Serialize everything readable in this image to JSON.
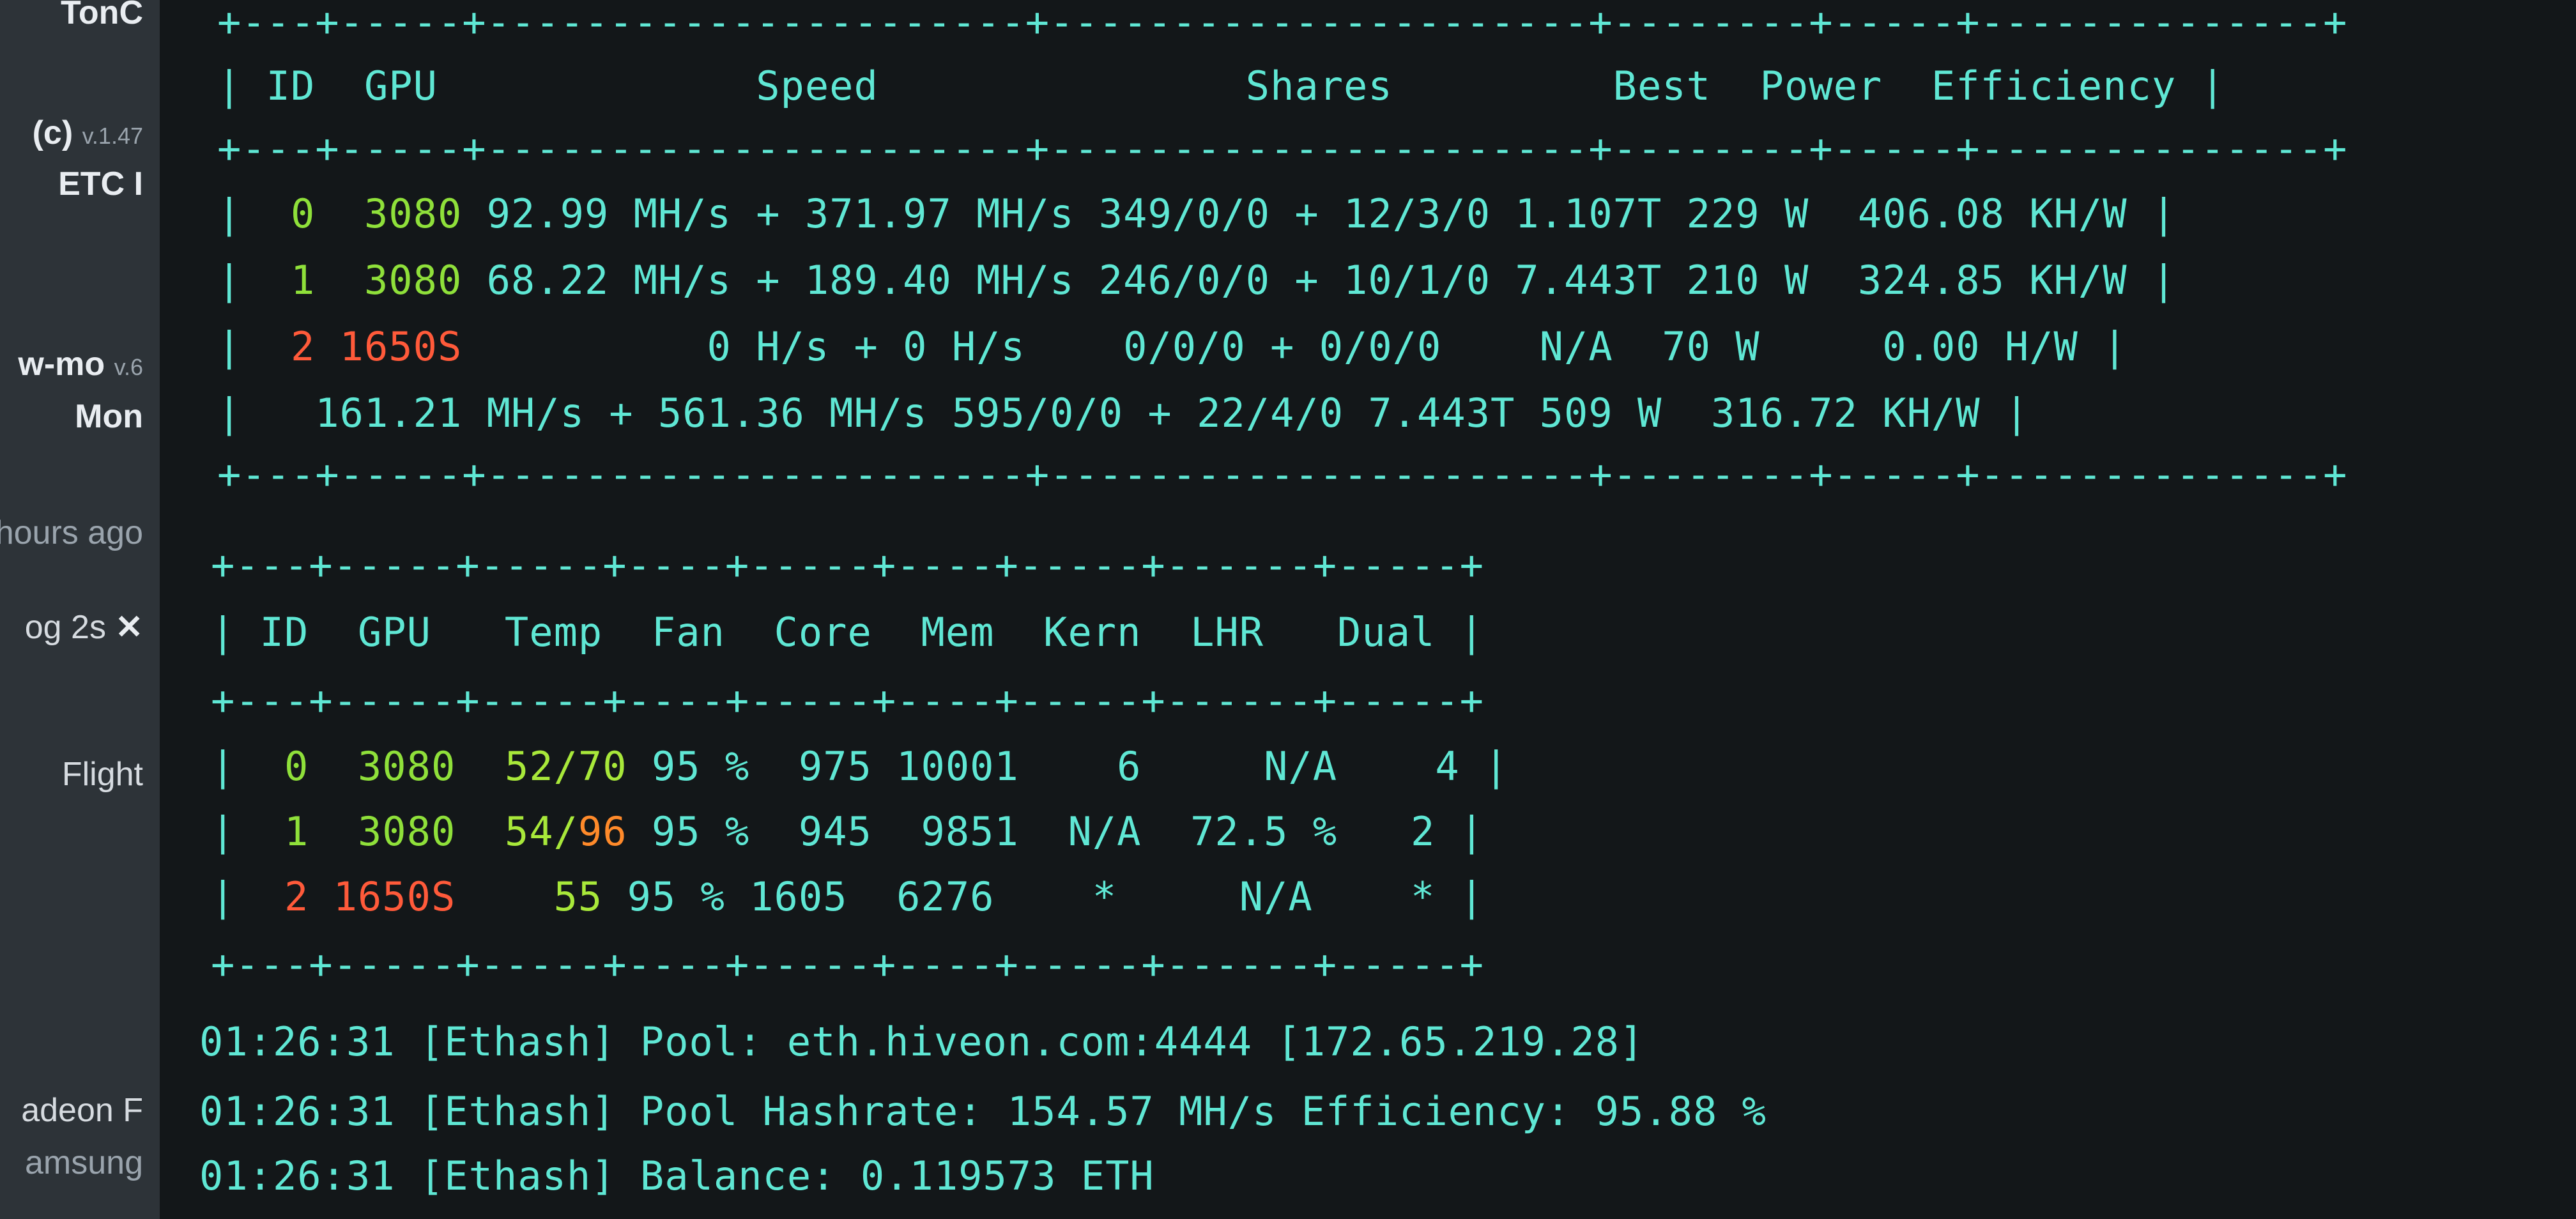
{
  "sidebar": {
    "items": [
      {
        "label": "TonC"
      },
      {
        "label": "(c)",
        "version": "v.1.47"
      },
      {
        "label": "ETC I"
      },
      {
        "label": "w-mo",
        "version": "v.6"
      },
      {
        "label": "Mon"
      },
      {
        "label": "hours ago"
      },
      {
        "label": "og 2s",
        "close": "✕"
      },
      {
        "label": "Flight"
      },
      {
        "label": "adeon F"
      },
      {
        "label": "amsung"
      }
    ]
  },
  "speed_table": {
    "separator_top": "+---+-----+----------------------+----------------------+--------+-----+--------------+",
    "header": "| ID  GPU             Speed               Shares         Best  Power  Efficiency |",
    "separator_mid": "+---+-----+----------------------+----------------------+--------+-----+--------------+",
    "rows": [
      {
        "bar": "|",
        "id": "0",
        "gpu": "3080",
        "rest": " 92.99 MH/s + 371.97 MH/s 349/0/0 + 12/3/0 1.107T 229 W  406.08 KH/W |"
      },
      {
        "bar": "|",
        "id": "1",
        "gpu": "3080",
        "rest": " 68.22 MH/s + 189.40 MH/s 246/0/0 + 10/1/0 7.443T 210 W  324.85 KH/W |"
      },
      {
        "bar": "|",
        "id": "2",
        "gpu": "1650S",
        "rest": "          0 H/s + 0 H/s    0/0/0 + 0/0/0    N/A  70 W     0.00 H/W |"
      },
      {
        "bar": "|",
        "id": "",
        "gpu": "",
        "rest": "   161.21 MH/s + 561.36 MH/s 595/0/0 + 22/4/0 7.443T 509 W  316.72 KH/W |"
      }
    ],
    "separator_bottom": "+---+-----+----------------------+----------------------+--------+-----+--------------+"
  },
  "hw_table": {
    "separator_top": "+---+-----+-----+----+-----+----+-----+------+-----+",
    "header": "| ID  GPU   Temp  Fan  Core  Mem  Kern  LHR   Dual |",
    "separator_mid": "+---+-----+-----+----+-----+----+-----+------+-----+",
    "rows": [
      {
        "bar": "|",
        "id": "0",
        "gpu": "3080",
        "temp_a": "52",
        "temp_b": "70",
        "rest": " 95 %  975 10001    6     N/A    4 |"
      },
      {
        "bar": "|",
        "id": "1",
        "gpu": "3080",
        "temp_a": "54",
        "temp_b": "96",
        "rest": " 95 %  945  9851  N/A  72.5 %   2 |"
      },
      {
        "bar": "|",
        "id": "2",
        "gpu": "1650S",
        "temp_a": "55",
        "temp_b": "",
        "rest": " 95 % 1605  6276    *     N/A    * |"
      }
    ],
    "separator_bottom": "+---+-----+-----+----+-----+----+-----+------+-----+"
  },
  "log": [
    "01:26:31 [Ethash] Pool: eth.hiveon.com:4444 [172.65.219.28]",
    "01:26:31 [Ethash] Pool Hashrate: 154.57 MH/s Efficiency: 95.88 %",
    "01:26:31 [Ethash] Balance: 0.119573 ETH"
  ],
  "colors": {
    "terminal_text": "#5fe7d4",
    "id_green": "#8fe03a",
    "id_red": "#ff5a3a",
    "temp_orange": "#ff8a2a",
    "background": "#131719"
  }
}
